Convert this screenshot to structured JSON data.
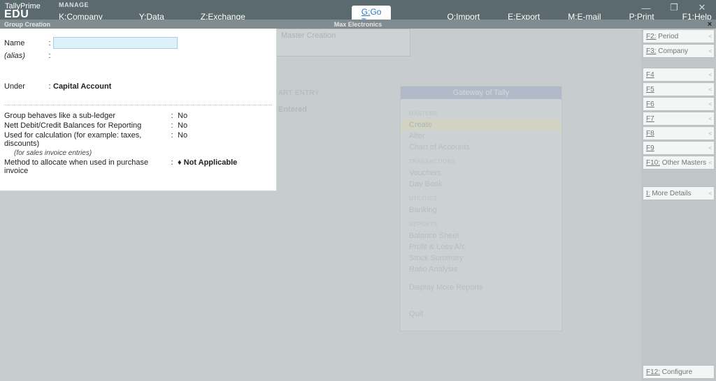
{
  "app": {
    "title": "TallyPrime",
    "edition": "EDU",
    "manage": "MANAGE"
  },
  "window_buttons": {
    "minimize": "—",
    "maximize": "❐",
    "close": "✕"
  },
  "menubar": {
    "company": {
      "key": "K:",
      "label": "Company"
    },
    "data": {
      "key": "Y:",
      "label": "Data"
    },
    "exchange": {
      "key": "Z:",
      "label": "Exchange"
    },
    "goto": {
      "key": "G:",
      "label": "Go To"
    },
    "import": {
      "key": "O:",
      "label": "Import"
    },
    "export": {
      "key": "E:",
      "label": "Export"
    },
    "email": {
      "key": "M:",
      "label": "E-mail"
    },
    "print": {
      "key": "P:",
      "label": "Print"
    },
    "help": {
      "key": "F1:",
      "label": "Help"
    }
  },
  "subheader": {
    "left": "Group Creation",
    "mid": "Max Electronics",
    "close": "×"
  },
  "master": {
    "title": "Master Creation",
    "label": "ART ENTRY",
    "status": "Entered"
  },
  "gateway": {
    "title": "Gateway of Tally",
    "sections": {
      "masters": {
        "title": "MASTERS",
        "items": [
          "Create",
          "Alter",
          "Chart of Accounts"
        ]
      },
      "transactions": {
        "title": "TRANSACTIONS",
        "items": [
          "Vouchers",
          "Day Book"
        ]
      },
      "utilities": {
        "title": "UTILITIES",
        "items": [
          "Banking"
        ]
      },
      "reports": {
        "title": "REPORTS",
        "items": [
          "Balance Sheet",
          "Profit & Loss A/c",
          "Stock Summary",
          "Ratio Analysis"
        ]
      }
    },
    "display_more": "Display More Reports",
    "quit": "Quit"
  },
  "dialog": {
    "name_label": "Name",
    "alias_label": "(alias)",
    "under_label": "Under",
    "under_value": "Capital Account",
    "subledger": {
      "label": "Group behaves like a sub-ledger",
      "value": "No"
    },
    "nett": {
      "label": "Nett Debit/Credit Balances for Reporting",
      "value": "No"
    },
    "calc": {
      "label": "Used for calculation (for example: taxes, discounts)",
      "note": "(for sales invoice entries)",
      "value": "No"
    },
    "alloc": {
      "label": "Method to allocate when used in purchase invoice",
      "value": "Not Applicable",
      "marker": "♦ "
    }
  },
  "sidebar": {
    "f2": {
      "key": "F2:",
      "label": "Period"
    },
    "f3": {
      "key": "F3:",
      "label": "Company"
    },
    "f4": {
      "key": "F4",
      "label": ""
    },
    "f5": {
      "key": "F5",
      "label": ""
    },
    "f6": {
      "key": "F6",
      "label": ""
    },
    "f7": {
      "key": "F7",
      "label": ""
    },
    "f8": {
      "key": "F8",
      "label": ""
    },
    "f9": {
      "key": "F9",
      "label": ""
    },
    "f10": {
      "key": "F10:",
      "label": "Other Masters"
    },
    "more": {
      "key": "I:",
      "label": "More Details"
    },
    "f12": {
      "key": "F12:",
      "label": "Configure"
    }
  }
}
